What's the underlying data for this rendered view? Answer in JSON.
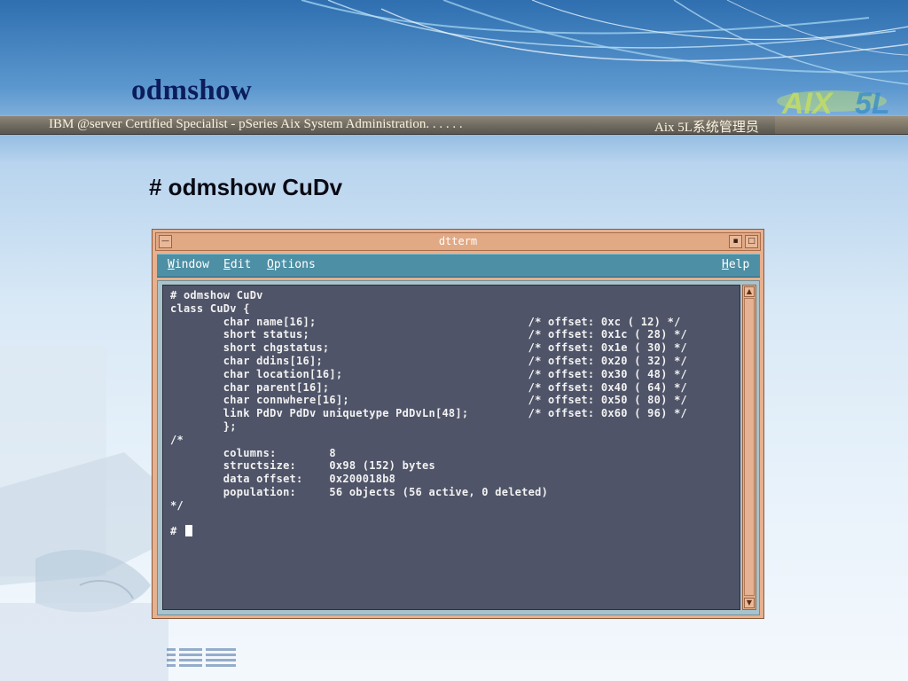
{
  "slide": {
    "title": "odmshow",
    "banner_left": "IBM @server Certified Specialist - pSeries Aix System Administration. . . . . .",
    "banner_right": "Aix 5L系统管理员",
    "logo_text": "AIX 5L",
    "command_heading": "# odmshow CuDv"
  },
  "window": {
    "title": "dtterm",
    "menu": [
      {
        "label": "Window",
        "mnemonic": "W",
        "rest": "indow"
      },
      {
        "label": "Edit",
        "mnemonic": "E",
        "rest": "dit"
      },
      {
        "label": "Options",
        "mnemonic": "O",
        "rest": "ptions"
      }
    ],
    "help": {
      "label": "Help",
      "mnemonic": "H",
      "rest": "elp"
    },
    "terminal_lines": [
      "# odmshow CuDv",
      "class CuDv {",
      "        char name[16];                                /* offset: 0xc ( 12) */",
      "        short status;                                 /* offset: 0x1c ( 28) */",
      "        short chgstatus;                              /* offset: 0x1e ( 30) */",
      "        char ddins[16];                               /* offset: 0x20 ( 32) */",
      "        char location[16];                            /* offset: 0x30 ( 48) */",
      "        char parent[16];                              /* offset: 0x40 ( 64) */",
      "        char connwhere[16];                           /* offset: 0x50 ( 80) */",
      "        link PdDv PdDv uniquetype PdDvLn[48];         /* offset: 0x60 ( 96) */",
      "        };",
      "/*",
      "        columns:        8",
      "        structsize:     0x98 (152) bytes",
      "        data offset:    0x200018b8",
      "        population:     56 objects (56 active, 0 deleted)",
      "*/",
      "",
      "# "
    ]
  },
  "brand": {
    "ibm": "IBM"
  },
  "colors": {
    "terminal_bg": "#4f5468",
    "menubar": "#4d8fa4",
    "window_frame": "#e7b08f",
    "title_text": "#0b1d5c"
  }
}
